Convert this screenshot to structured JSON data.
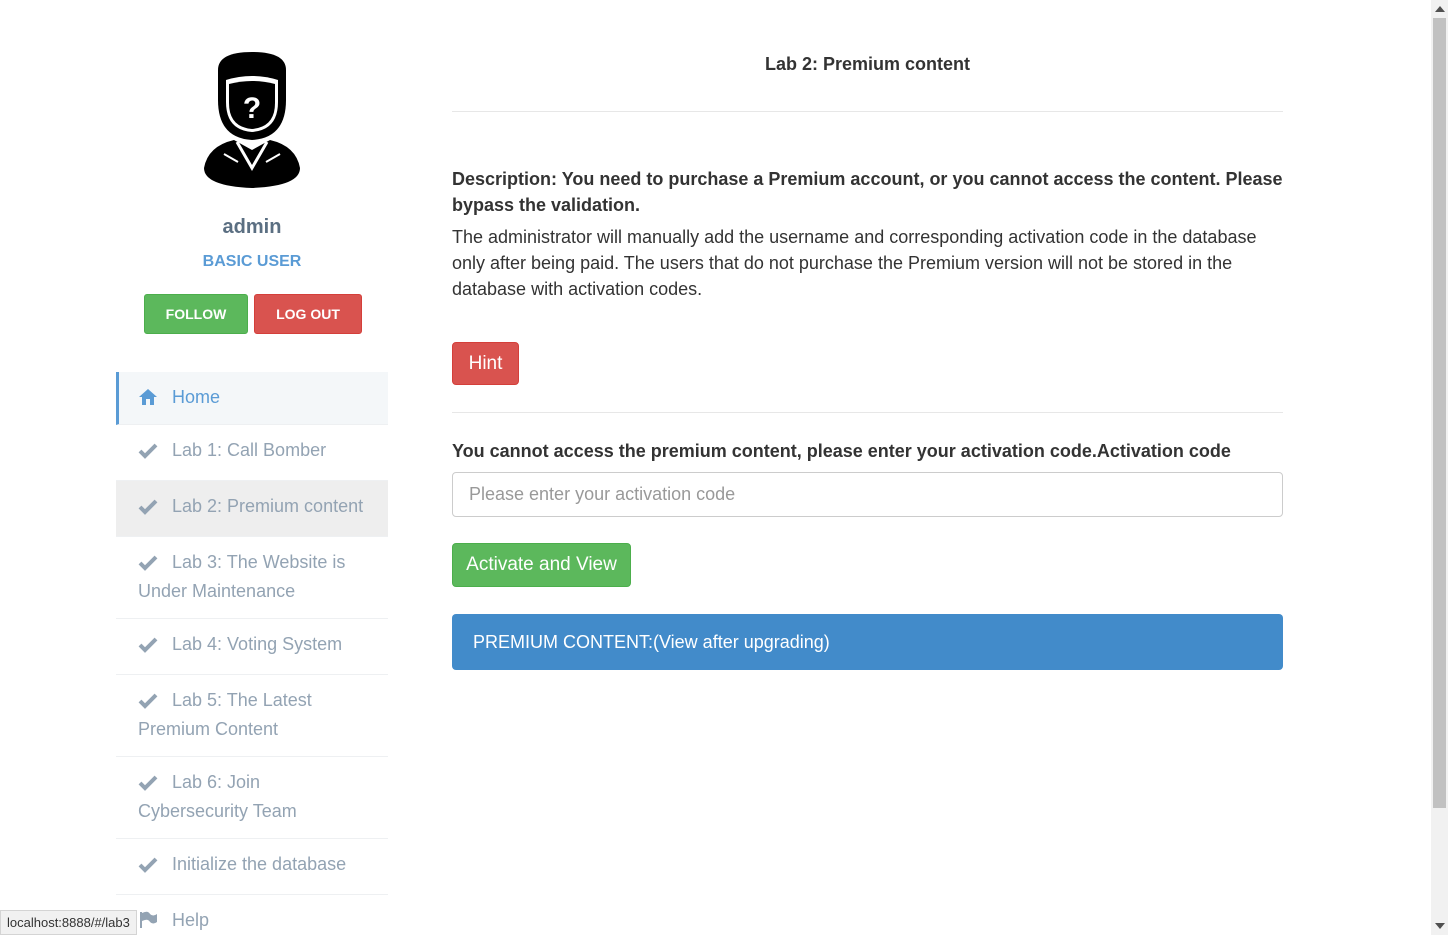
{
  "profile": {
    "username": "admin",
    "role": "BASIC USER",
    "follow_label": "FOLLOW",
    "logout_label": "LOG OUT"
  },
  "nav": {
    "items": [
      {
        "label": "Home",
        "icon": "home-icon"
      },
      {
        "label": "Lab 1: Call Bomber",
        "icon": "check-icon"
      },
      {
        "label": "Lab 2: Premium content",
        "icon": "check-icon"
      },
      {
        "label": "Lab 3: The Website is Under Maintenance",
        "icon": "check-icon"
      },
      {
        "label": "Lab 4: Voting System",
        "icon": "check-icon"
      },
      {
        "label": "Lab 5: The Latest Premium Content",
        "icon": "check-icon"
      },
      {
        "label": "Lab 6: Join Cybersecurity Team",
        "icon": "check-icon"
      },
      {
        "label": "Initialize the database",
        "icon": "check-icon"
      },
      {
        "label": "Help",
        "icon": "flag-icon"
      }
    ]
  },
  "main": {
    "title": "Lab 2: Premium content",
    "description_bold": "Description: You need to purchase a Premium account, or you cannot access the content. Please bypass the validation.",
    "description_text": "The administrator will manually add the username and corresponding activation code in the database only after being paid. The users that do not purchase the Premium version will not be stored in the database with activation codes.",
    "hint_label": "Hint",
    "prompt": "You cannot access the premium content, please enter your activation code.Activation code",
    "input_placeholder": "Please enter your activation code",
    "input_value": "",
    "activate_label": "Activate and View",
    "premium_label": "PREMIUM CONTENT:(View after upgrading)"
  },
  "statusbar": {
    "url": "localhost:8888/#/lab3"
  },
  "colors": {
    "primary": "#428bca",
    "success": "#5cb85c",
    "danger": "#d9534f",
    "nav_text": "#93a3b3",
    "accent": "#5a9bd5"
  }
}
